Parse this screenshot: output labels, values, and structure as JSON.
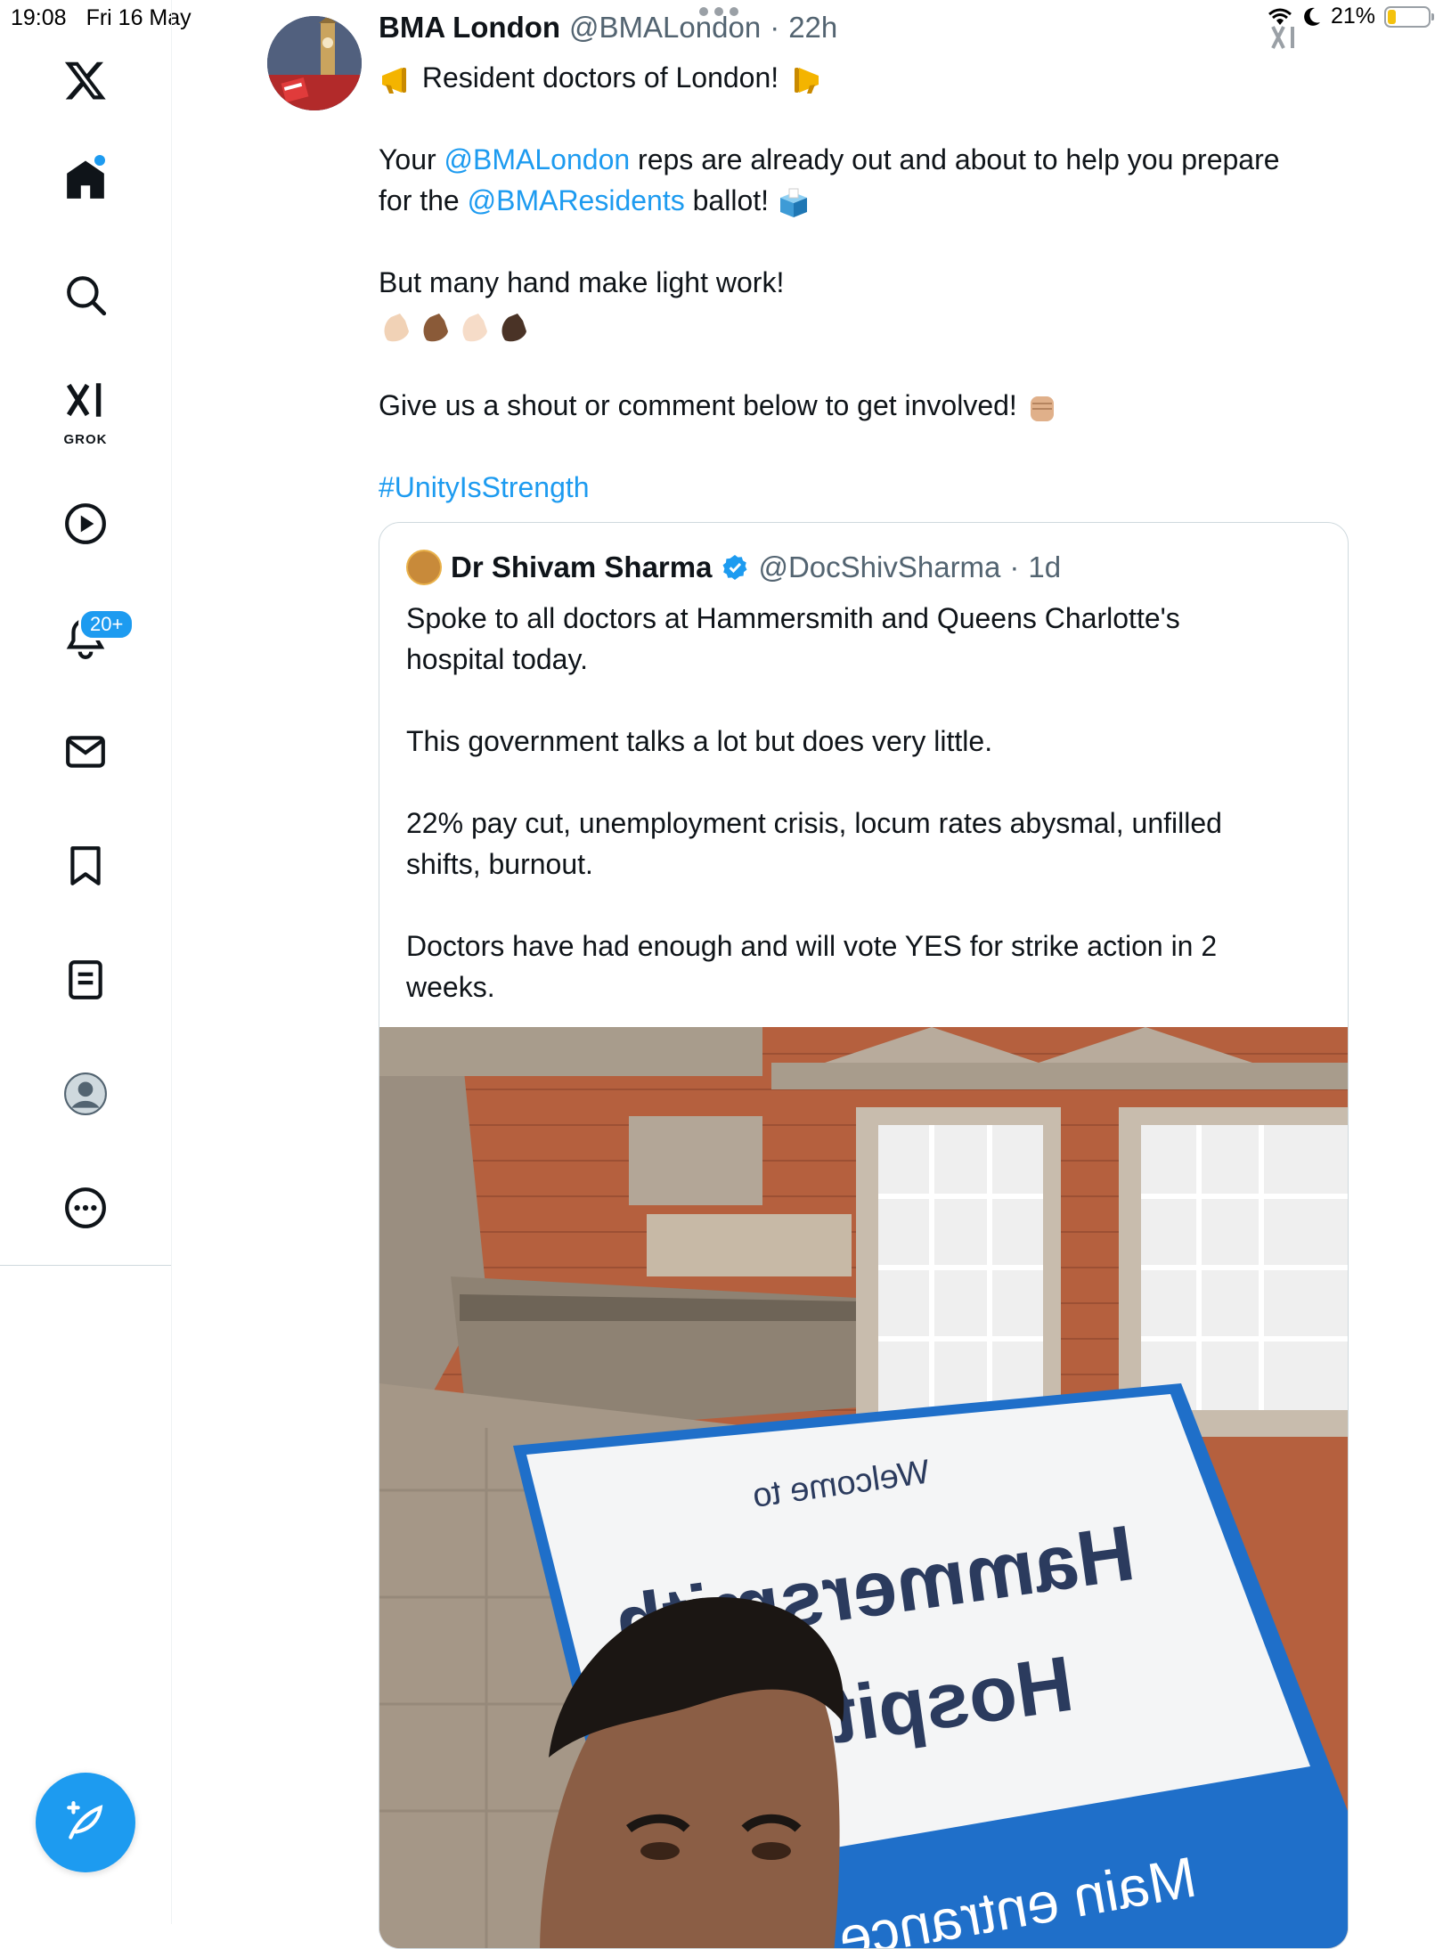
{
  "status_bar": {
    "time": "19:08",
    "date": "Fri 16 May",
    "battery": "21%",
    "battery_fraction": 0.21
  },
  "sidebar": {
    "grok_label": "GROK",
    "notifications_badge": "20+"
  },
  "tweet": {
    "author_name": "BMA London",
    "author_handle": "@BMALondon",
    "separator": "·",
    "time": "22h",
    "line1": "Resident doctors of London!",
    "line2_a": "Your ",
    "line2_mention": "@BMALondon",
    "line2_b": " reps are already out and about to help you prepare",
    "line3_a": "for the ",
    "line3_mention": "@BMAResidents",
    "line3_b": " ballot!",
    "line4": "But many hand make light work!",
    "line5": "Give us a shout or comment below to get involved!",
    "hashtag": "#UnityIsStrength"
  },
  "quote": {
    "author_name": "Dr Shivam Sharma",
    "author_handle": "@DocShivSharma",
    "separator": "·",
    "time": "1d",
    "p1_l1": "Spoke to all doctors at Hammersmith and Queens Charlotte's",
    "p1_l2": "hospital today.",
    "p2": "This government talks a lot but does very little.",
    "p3_l1": "22% pay cut, unemployment crisis, locum rates abysmal, unfilled",
    "p3_l2": "shifts, burnout.",
    "p4_l1": "Doctors have had enough and will vote YES for strike action in 2",
    "p4_l2": "weeks.",
    "photo_sign_line1": "Welcome to",
    "photo_sign_line2": "Hammersmith",
    "photo_sign_line3": "Hospital",
    "photo_sign_line4": "Main entrance"
  },
  "colors": {
    "accent": "#1d9bf0",
    "text": "#0f1419",
    "secondary": "#536471"
  }
}
